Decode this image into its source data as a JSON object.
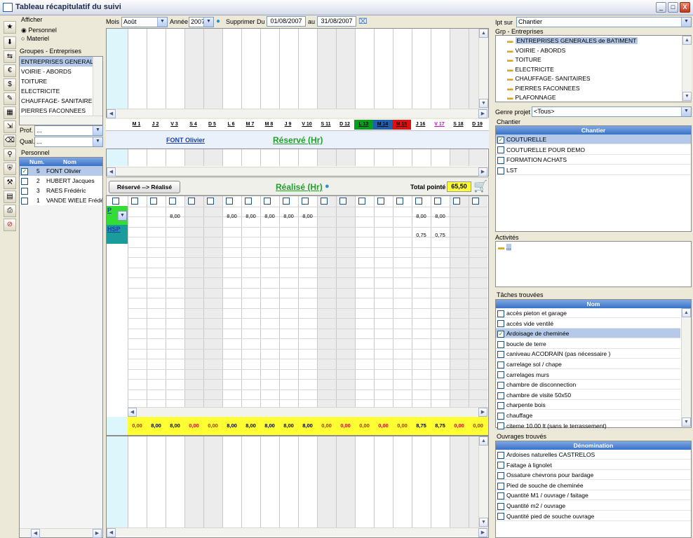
{
  "window": {
    "title": "Tableau récapitulatif du suivi",
    "min": "_",
    "max": "□",
    "close": "X"
  },
  "left": {
    "afficher": "Afficher",
    "radio": [
      {
        "label": "Personnel",
        "checked": true
      },
      {
        "label": "Materiel",
        "checked": false
      }
    ],
    "groups_label": "Groupes - Entreprises",
    "groups": [
      "ENTREPRISES GENERALES de",
      "VOIRIE - ABORDS",
      "TOITURE",
      "ELECTRICITE",
      "CHAUFFAGE- SANITAIRES",
      "PIERRES FACONNEES"
    ],
    "prof_label": "Prof.",
    "prof_value": "...",
    "qual_label": "Qual.",
    "qual_value": "...",
    "personnel_label": "Personnel",
    "cols": [
      "Num.",
      "Nom"
    ],
    "people": [
      {
        "num": "5",
        "name": "FONT Olivier",
        "checked": true
      },
      {
        "num": "2",
        "name": "HUBERT Jacques",
        "checked": false
      },
      {
        "num": "3",
        "name": "RAES Frédéric",
        "checked": false
      },
      {
        "num": "1",
        "name": "VANDE WIELE Frédé",
        "checked": false
      }
    ]
  },
  "toolbar": {
    "mois_label": "Mois",
    "mois": "Août",
    "annee_label": "Année",
    "annee": "2007",
    "supprimer": "Supprimer Du",
    "du": "01/08/2007",
    "au_label": "au",
    "au": "31/08/2007"
  },
  "days": [
    "M 1",
    "J 2",
    "V 3",
    "S 4",
    "D 5",
    "L 6",
    "M 7",
    "M 8",
    "J 9",
    "V 10",
    "S 11",
    "D 12",
    "L 13",
    "M 14",
    "M 15",
    "J 16",
    "V 17",
    "S 18",
    "D 19"
  ],
  "reserve": {
    "person": "FONT Olivier",
    "title": "Réservé (Hr)"
  },
  "realise": {
    "button": "Réservé --> Réalisé",
    "title": "Réalisé (Hr)",
    "total_label": "Total pointé",
    "total": "65,50",
    "rows": [
      {
        "code": "P",
        "values": [
          "",
          "",
          "8,00",
          "",
          "",
          "8,00",
          "8,00",
          "8,00",
          "8,00",
          "8,00",
          "",
          "",
          "",
          "",
          "",
          "8,00",
          "8,00",
          "",
          ""
        ]
      },
      {
        "code": "HSP",
        "values": [
          "",
          "",
          "",
          "",
          "",
          "",
          "",
          "",
          "",
          "",
          "",
          "",
          "",
          "",
          "",
          "0,75",
          "0,75",
          "",
          ""
        ]
      }
    ],
    "totals": [
      "0,00",
      "8,00",
      "8,00",
      "0,00",
      "0,00",
      "8,00",
      "8,00",
      "8,00",
      "8,00",
      "8,00",
      "0,00",
      "0,00",
      "0,00",
      "0,00",
      "0,00",
      "8,75",
      "8,75",
      "0,00",
      "0,00"
    ]
  },
  "right": {
    "ipt_label": "Ipt sur",
    "ipt": "Chantier",
    "grp_label": "Grp - Entreprises",
    "grp_items": [
      "ENTREPRISES GENERALES de BATIMENT",
      "VOIRIE - ABORDS",
      "TOITURE",
      "ELECTRICITE",
      "CHAUFFAGE- SANITAIRES",
      "PIERRES FACONNEES",
      "PLAFONNAGE"
    ],
    "genre_label": "Genre projet",
    "genre": "<Tous>",
    "chantier_label": "Chantier",
    "chantier_col": "Chantier",
    "chantiers": [
      {
        "name": "COUTURELLE",
        "checked": true
      },
      {
        "name": "COUTURELLE POUR DEMO",
        "checked": false
      },
      {
        "name": "FORMATION  ACHATS",
        "checked": false
      },
      {
        "name": "LST",
        "checked": false
      }
    ],
    "activites_label": "Activités",
    "activite": "...",
    "taches_label": "Tâches trouvées",
    "taches_col": "Nom",
    "taches": [
      {
        "name": "accès pieton et garage",
        "checked": false
      },
      {
        "name": "accès vide ventilé",
        "checked": false
      },
      {
        "name": "Ardoisage de cheminée",
        "checked": true
      },
      {
        "name": "boucle de terre",
        "checked": false
      },
      {
        "name": "caniveau ACODRAIN  (pas nécessaire )",
        "checked": false
      },
      {
        "name": "carrelage sol / chape",
        "checked": false
      },
      {
        "name": "carrelages murs",
        "checked": false
      },
      {
        "name": "chambre de disconnection",
        "checked": false
      },
      {
        "name": "chambre de visite 50x50",
        "checked": false
      },
      {
        "name": "charpente bois",
        "checked": false
      },
      {
        "name": "chauffage",
        "checked": false
      },
      {
        "name": "citerne 10.00 lt (sans le terrassement)",
        "checked": false
      }
    ],
    "ouvrages_label": "Ouvrages trouvés",
    "ouvrages_col": "Dénomination",
    "ouvrages": [
      {
        "name": "Ardoises naturelles CASTRELOS",
        "checked": false
      },
      {
        "name": "Faitage à lignolet",
        "checked": false
      },
      {
        "name": "Ossature chevrons pour bardage",
        "checked": false
      },
      {
        "name": "Pied de souche de cheminée",
        "checked": false
      },
      {
        "name": "Quantité M1 / ouvrage / faitage",
        "checked": false
      },
      {
        "name": "Quantité m2 / ouvrage",
        "checked": false
      },
      {
        "name": "Quantité pied de souche ouvrage",
        "checked": false
      }
    ]
  },
  "colors": {
    "green": "#00a01a",
    "blue": "#1f5fb0",
    "red": "#e01010",
    "yellow": "#ffff33",
    "cyan": "#ddf6fb"
  }
}
